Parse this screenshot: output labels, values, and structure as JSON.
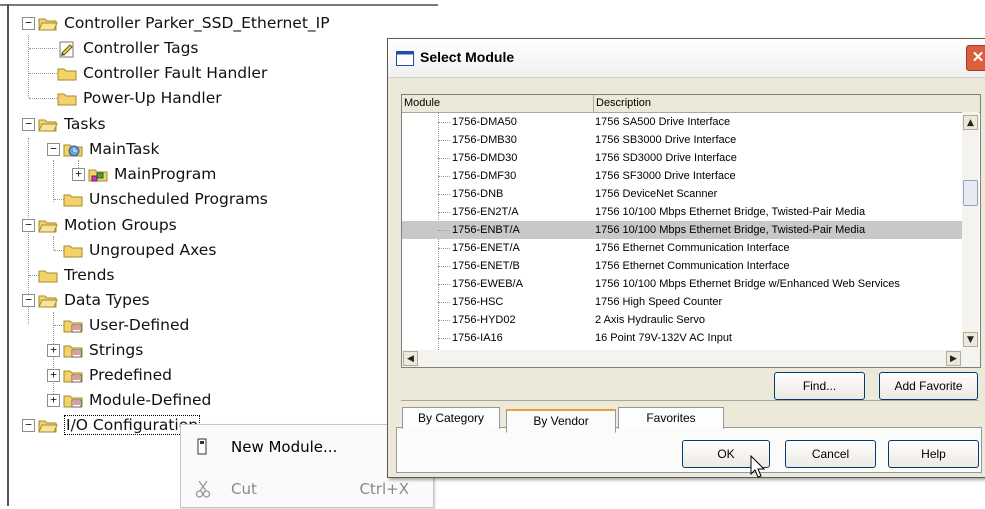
{
  "tree": {
    "items": [
      {
        "label": "Controller Parker_SSD_Ethernet_IP",
        "icon": "folder-icon"
      },
      {
        "label": "Controller Tags",
        "icon": "tags-icon"
      },
      {
        "label": "Controller Fault Handler",
        "icon": "folder-icon"
      },
      {
        "label": "Power-Up Handler",
        "icon": "folder-icon"
      },
      {
        "label": "Tasks",
        "icon": "folder-icon"
      },
      {
        "label": "MainTask",
        "icon": "task-icon"
      },
      {
        "label": "MainProgram",
        "icon": "program-icon"
      },
      {
        "label": "Unscheduled Programs",
        "icon": "folder-icon"
      },
      {
        "label": "Motion Groups",
        "icon": "folder-icon"
      },
      {
        "label": "Ungrouped Axes",
        "icon": "folder-icon"
      },
      {
        "label": "Trends",
        "icon": "folder-icon"
      },
      {
        "label": "Data Types",
        "icon": "folder-icon"
      },
      {
        "label": "User-Defined",
        "icon": "datatype-icon"
      },
      {
        "label": "Strings",
        "icon": "datatype-icon"
      },
      {
        "label": "Predefined",
        "icon": "datatype-icon"
      },
      {
        "label": "Module-Defined",
        "icon": "datatype-icon"
      },
      {
        "label": "I/O Configuration",
        "icon": "folder-icon"
      }
    ]
  },
  "context_menu": {
    "new_module": {
      "label": "New Module...",
      "icon": "module-icon"
    },
    "cut": {
      "label": "Cut",
      "shortcut": "Ctrl+X",
      "icon": "scissors-icon",
      "disabled": true
    }
  },
  "dialog": {
    "title": "Select Module",
    "columns": {
      "module": "Module",
      "description": "Description"
    },
    "rows": [
      {
        "module": "1756-DMA50",
        "description": "1756 SA500 Drive Interface"
      },
      {
        "module": "1756-DMB30",
        "description": "1756 SB3000 Drive Interface"
      },
      {
        "module": "1756-DMD30",
        "description": "1756 SD3000 Drive Interface"
      },
      {
        "module": "1756-DMF30",
        "description": "1756 SF3000 Drive Interface"
      },
      {
        "module": "1756-DNB",
        "description": "1756 DeviceNet Scanner"
      },
      {
        "module": "1756-EN2T/A",
        "description": "1756 10/100 Mbps Ethernet Bridge, Twisted-Pair Media"
      },
      {
        "module": "1756-ENBT/A",
        "description": "1756 10/100 Mbps Ethernet Bridge, Twisted-Pair Media",
        "selected": true
      },
      {
        "module": "1756-ENET/A",
        "description": "1756 Ethernet Communication Interface"
      },
      {
        "module": "1756-ENET/B",
        "description": "1756 Ethernet Communication Interface"
      },
      {
        "module": "1756-EWEB/A",
        "description": "1756 10/100 Mbps Ethernet Bridge w/Enhanced Web Services"
      },
      {
        "module": "1756-HSC",
        "description": "1756 High Speed Counter"
      },
      {
        "module": "1756-HYD02",
        "description": "2 Axis Hydraulic Servo"
      },
      {
        "module": "1756-IA16",
        "description": "16 Point 79V-132V AC Input"
      }
    ],
    "buttons": {
      "find": "Find...",
      "add_favorite": "Add Favorite",
      "ok": "OK",
      "cancel": "Cancel",
      "help": "Help"
    },
    "tabs": [
      {
        "label": "By Category"
      },
      {
        "label": "By Vendor",
        "active": true
      },
      {
        "label": "Favorites"
      }
    ]
  },
  "colors": {
    "selected_row": "#c8c8c8",
    "folder": "#f2d36b",
    "close_button": "#d9603a",
    "dialog_bg": "#ece9d8"
  }
}
